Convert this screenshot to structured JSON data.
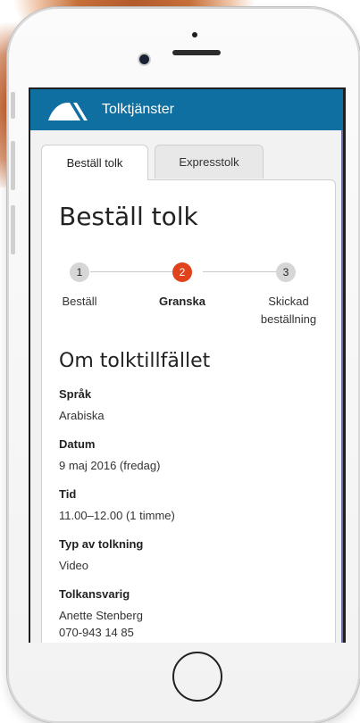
{
  "header": {
    "brand": "Tolktjänster",
    "logo_icon": "tolkservice-logo-icon",
    "bar_color": "#0e6fa0"
  },
  "tabs": [
    {
      "label": "Beställ tolk",
      "active": true
    },
    {
      "label": "Expresstolk",
      "active": false
    }
  ],
  "page": {
    "title": "Beställ tolk"
  },
  "steps": [
    {
      "number": "1",
      "label": "Beställ",
      "state": "done"
    },
    {
      "number": "2",
      "label": "Granska",
      "state": "current"
    },
    {
      "number": "3",
      "label_line1": "Skickad",
      "label_line2": "beställning",
      "state": "upcoming"
    }
  ],
  "section": {
    "title": "Om tolktillfället"
  },
  "fields": {
    "sprak": {
      "label": "Språk",
      "value": "Arabiska"
    },
    "datum": {
      "label": "Datum",
      "value": "9 maj 2016 (fredag)"
    },
    "tid": {
      "label": "Tid",
      "value": "11.00–12.00 (1 timme)"
    },
    "typ": {
      "label": "Typ av tolkning",
      "value": "Video"
    },
    "tolkansvarig": {
      "label": "Tolkansvarig",
      "name": "Anette Stenberg",
      "phone": "070-943 14 85"
    }
  },
  "colors": {
    "accent": "#e0431c",
    "step_done": "#d6d6d6"
  }
}
